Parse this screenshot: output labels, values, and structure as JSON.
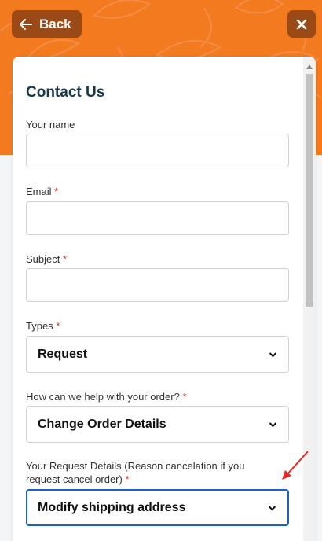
{
  "header": {
    "back_label": "Back"
  },
  "form": {
    "title": "Contact Us",
    "name_label": "Your name",
    "email_label": "Email",
    "subject_label": "Subject",
    "types_label": "Types",
    "types_value": "Request",
    "help_label": "How can we help with your order?",
    "help_value": "Change Order Details",
    "details_label": "Your Request Details (Reason cancelation if you request cancel order)",
    "details_value": "Modify shipping address",
    "required_mark": "*"
  },
  "colors": {
    "banner": "#f47a1f",
    "header_buttons": "#9a4a17",
    "title": "#17384a",
    "required": "#d9322b",
    "focus_border": "#1c5fcc",
    "annotation_arrow": "#e8271f"
  },
  "icons": [
    "arrow-left-icon",
    "close-icon",
    "chevron-down-icon",
    "annotation-arrow-icon"
  ]
}
